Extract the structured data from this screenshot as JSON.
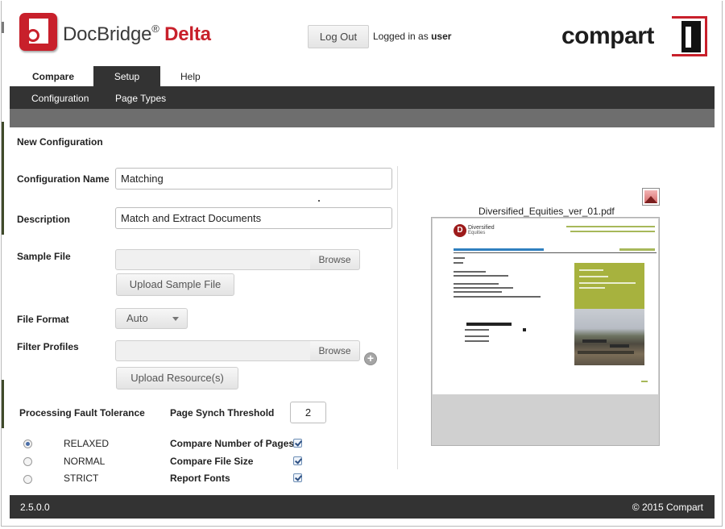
{
  "header": {
    "brand_name": "DocBridge",
    "brand_reg": "®",
    "brand_product": "Delta",
    "logout_label": "Log Out",
    "logged_in_prefix": "Logged in as",
    "logged_in_user": "user",
    "company_logo_text": "compart",
    "brand_color": "#c8202b"
  },
  "tabs": [
    {
      "label": "Compare",
      "active": false
    },
    {
      "label": "Setup",
      "active": true
    },
    {
      "label": "Help",
      "active": false
    }
  ],
  "subnav": [
    {
      "label": "Configuration"
    },
    {
      "label": "Page Types"
    }
  ],
  "form": {
    "section_title": "New Configuration",
    "config_name_label": "Configuration Name",
    "config_name_value": "Matching",
    "description_label": "Description",
    "description_value": "Match and Extract Documents",
    "sample_file_label": "Sample File",
    "browse_label": "Browse",
    "upload_sample_label": "Upload Sample File",
    "file_format_label": "File Format",
    "file_format_value": "Auto",
    "filter_profiles_label": "Filter Profiles",
    "upload_resource_label": "Upload Resource(s)",
    "fault_tolerance_label": "Processing Fault Tolerance",
    "fault_options": [
      {
        "label": "RELAXED",
        "selected": true
      },
      {
        "label": "NORMAL",
        "selected": false
      },
      {
        "label": "STRICT",
        "selected": false
      }
    ],
    "threshold_label": "Page Synch Threshold",
    "threshold_value": "2",
    "checks": [
      {
        "label": "Compare Number of Pages",
        "checked": true
      },
      {
        "label": "Compare File Size",
        "checked": true
      },
      {
        "label": "Report Fonts",
        "checked": true
      }
    ]
  },
  "preview": {
    "file_name": "Diversified_Equities_ver_01.pdf",
    "doc_logo_letter": "D",
    "doc_name_1": "Diversified",
    "doc_name_2": "Equities",
    "accent_color": "#a7b23e"
  },
  "footer": {
    "version": "2.5.0.0",
    "copyright": "© 2015 Compart"
  }
}
